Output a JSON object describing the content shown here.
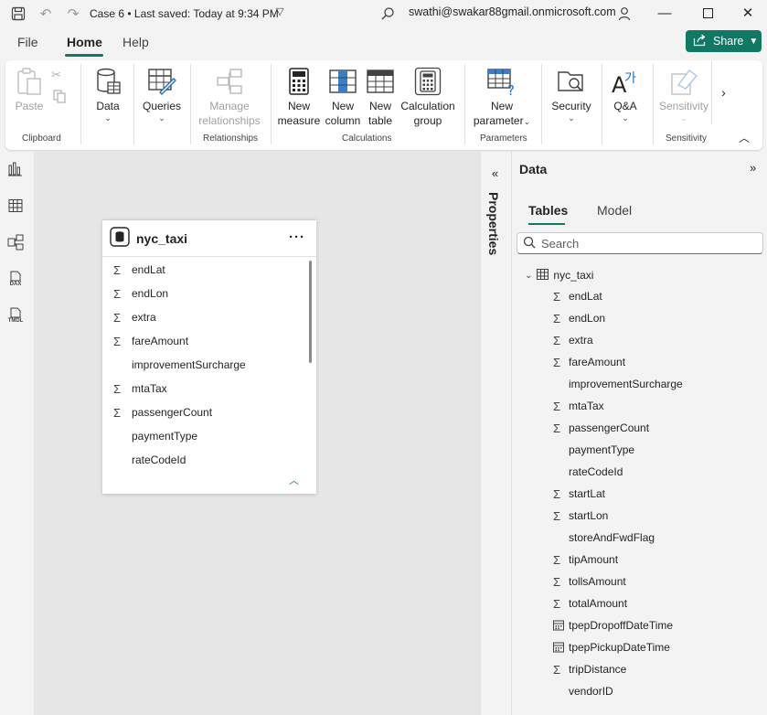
{
  "titlebar": {
    "doc_title": "Case 6 • Last saved: Today at 9:34 PM",
    "user": "swathi@swakar88gmail.onmicrosoft.com"
  },
  "menu": {
    "tabs": [
      "File",
      "Home",
      "Help"
    ],
    "active": "Home",
    "share_label": "Share"
  },
  "ribbon": {
    "paste": "Paste",
    "data": "Data",
    "queries": "Queries",
    "manage_relationships_1": "Manage",
    "manage_relationships_2": "relationships",
    "new_measure_1": "New",
    "new_measure_2": "measure",
    "new_column_1": "New",
    "new_column_2": "column",
    "new_table_1": "New",
    "new_table_2": "table",
    "calc_group_1": "Calculation",
    "calc_group_2": "group",
    "new_parameter_1": "New",
    "new_parameter_2": "parameter",
    "security": "Security",
    "qa": "Q&A",
    "sensitivity": "Sensitivity",
    "groups": {
      "clipboard": "Clipboard",
      "relationships": "Relationships",
      "calculations": "Calculations",
      "parameters": "Parameters",
      "sensitivity": "Sensitivity"
    }
  },
  "rail": {
    "dax_label": "DAX",
    "tmdl_label": "TMDL"
  },
  "card": {
    "title": "nyc_taxi",
    "fields": [
      {
        "name": "endLat",
        "sum": true
      },
      {
        "name": "endLon",
        "sum": true
      },
      {
        "name": "extra",
        "sum": true
      },
      {
        "name": "fareAmount",
        "sum": true
      },
      {
        "name": "improvementSurcharge",
        "sum": false
      },
      {
        "name": "mtaTax",
        "sum": true
      },
      {
        "name": "passengerCount",
        "sum": true
      },
      {
        "name": "paymentType",
        "sum": false
      },
      {
        "name": "rateCodeId",
        "sum": false
      }
    ]
  },
  "properties": {
    "label": "Properties"
  },
  "data_pane": {
    "title": "Data",
    "tabs": [
      "Tables",
      "Model"
    ],
    "active_tab": "Tables",
    "search_placeholder": "Search",
    "table_name": "nyc_taxi",
    "fields": [
      {
        "name": "endLat",
        "type": "sum"
      },
      {
        "name": "endLon",
        "type": "sum"
      },
      {
        "name": "extra",
        "type": "sum"
      },
      {
        "name": "fareAmount",
        "type": "sum"
      },
      {
        "name": "improvementSurcharge",
        "type": "none"
      },
      {
        "name": "mtaTax",
        "type": "sum"
      },
      {
        "name": "passengerCount",
        "type": "sum"
      },
      {
        "name": "paymentType",
        "type": "none"
      },
      {
        "name": "rateCodeId",
        "type": "none"
      },
      {
        "name": "startLat",
        "type": "sum"
      },
      {
        "name": "startLon",
        "type": "sum"
      },
      {
        "name": "storeAndFwdFlag",
        "type": "none"
      },
      {
        "name": "tipAmount",
        "type": "sum"
      },
      {
        "name": "tollsAmount",
        "type": "sum"
      },
      {
        "name": "totalAmount",
        "type": "sum"
      },
      {
        "name": "tpepDropoffDateTime",
        "type": "date"
      },
      {
        "name": "tpepPickupDateTime",
        "type": "date"
      },
      {
        "name": "tripDistance",
        "type": "sum"
      },
      {
        "name": "vendorID",
        "type": "none"
      }
    ]
  },
  "colors": {
    "accent": "#117865",
    "canvas": "#e6e6e6"
  }
}
